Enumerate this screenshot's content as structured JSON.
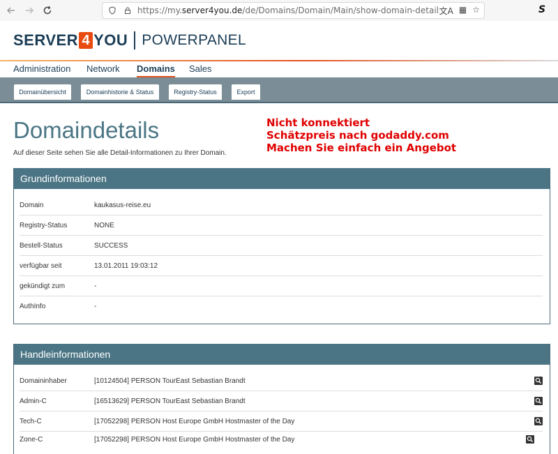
{
  "browser": {
    "url_prefix": "https://my.",
    "url_host": "server4you.de",
    "url_path": "/de/Domains/Domain/Main/show-domain-details/name/kaukasus-reise.eu",
    "ext_label": "S"
  },
  "logo": {
    "part1": "SERVER",
    "part2": "4",
    "part3": "YOU",
    "part4": "POWERPANEL"
  },
  "main_nav": [
    {
      "label": "Administration",
      "active": false
    },
    {
      "label": "Network",
      "active": false
    },
    {
      "label": "Domains",
      "active": true
    },
    {
      "label": "Sales",
      "active": false
    }
  ],
  "sub_tabs": [
    {
      "label": "Domainübersicht"
    },
    {
      "label": "Domainhistorie & Status"
    },
    {
      "label": "Registry-Status"
    },
    {
      "label": "Export"
    }
  ],
  "page": {
    "title": "Domaindetails",
    "description": "Auf dieser Seite sehen Sie alle Detail-Informationen zu Ihrer Domain."
  },
  "note": {
    "line1": "Nicht konnektiert",
    "line2": "Schätzpreis nach godaddy.com",
    "line3": "Machen Sie einfach ein Angebot"
  },
  "grund": {
    "title": "Grundinformationen",
    "rows": [
      {
        "label": "Domain",
        "value": "kaukasus-reise.eu"
      },
      {
        "label": "Registry-Status",
        "value": "NONE"
      },
      {
        "label": "Bestell-Status",
        "value": "SUCCESS"
      },
      {
        "label": "verfügbar seit",
        "value": "13.01.2011 19:03:12"
      },
      {
        "label": "gekündigt zum",
        "value": "-"
      },
      {
        "label": "AuthInfo",
        "value": "-"
      }
    ]
  },
  "handle": {
    "title": "Handleinformationen",
    "rows": [
      {
        "label": "Domaininhaber",
        "value": "[10124504] PERSON TourEast Sebastian Brandt"
      },
      {
        "label": "Admin-C",
        "value": "[16513629] PERSON TourEast Sebastian Brandt"
      },
      {
        "label": "Tech-C",
        "value": "[17052298] PERSON Host Europe GmbH Hostmaster of the Day"
      },
      {
        "label": "Zone-C",
        "value": "[17052298] PERSON Host Europe GmbH Hostmaster of the Day"
      }
    ]
  }
}
